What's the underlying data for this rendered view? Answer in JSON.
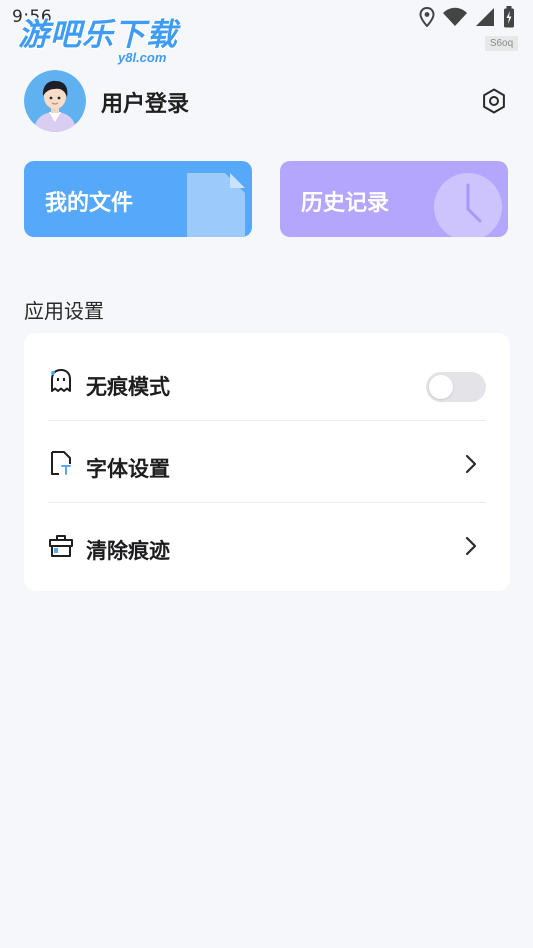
{
  "status_bar": {
    "time": "9:56"
  },
  "watermark": {
    "title": "游吧乐下载",
    "url": "y8l.com",
    "tag": "S6oq"
  },
  "user": {
    "login_label": "用户登录"
  },
  "cards": {
    "files": {
      "label": "我的文件",
      "color": "#56a8fa"
    },
    "history": {
      "label": "历史记录",
      "color": "#b3a6fc"
    }
  },
  "settings_section": {
    "title": "应用设置",
    "items": [
      {
        "label": "无痕模式",
        "icon": "ghost-icon",
        "control": "toggle",
        "enabled": false
      },
      {
        "label": "字体设置",
        "icon": "font-file-icon",
        "control": "chevron"
      },
      {
        "label": "清除痕迹",
        "icon": "clear-box-icon",
        "control": "chevron"
      }
    ]
  },
  "colors": {
    "accent": "#3f9cf5",
    "background": "#f6f7fb"
  }
}
